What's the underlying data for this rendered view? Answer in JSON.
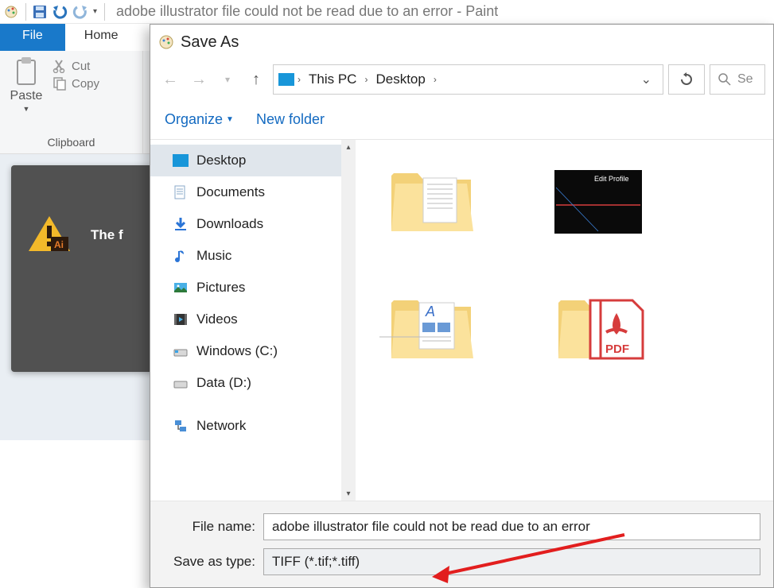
{
  "qat": {
    "title": "adobe illustrator file could not be read due to an error - Paint"
  },
  "ribbon": {
    "file": "File",
    "home": "Home",
    "paste": "Paste",
    "cut": "Cut",
    "copy": "Copy",
    "clipboard_label": "Clipboard"
  },
  "thumb": {
    "text": "The f"
  },
  "dialog": {
    "title": "Save As",
    "crumb1": "This PC",
    "crumb2": "Desktop",
    "search_placeholder": "Se",
    "organize": "Organize",
    "newfolder": "New folder"
  },
  "tree": {
    "items": [
      {
        "label": "Desktop",
        "icon": "desktop"
      },
      {
        "label": "Documents",
        "icon": "documents"
      },
      {
        "label": "Downloads",
        "icon": "downloads"
      },
      {
        "label": "Music",
        "icon": "music"
      },
      {
        "label": "Pictures",
        "icon": "pictures"
      },
      {
        "label": "Videos",
        "icon": "videos"
      },
      {
        "label": "Windows (C:)",
        "icon": "drive"
      },
      {
        "label": "Data (D:)",
        "icon": "drive"
      }
    ],
    "network": "Network"
  },
  "folders": {
    "item2_label": "Edit Profile",
    "pdf_label": "PDF"
  },
  "bottom": {
    "filename_label": "File name:",
    "filename_value": "adobe illustrator file could not be read due to an error",
    "type_label": "Save as type:",
    "type_value": "TIFF (*.tif;*.tiff)"
  }
}
